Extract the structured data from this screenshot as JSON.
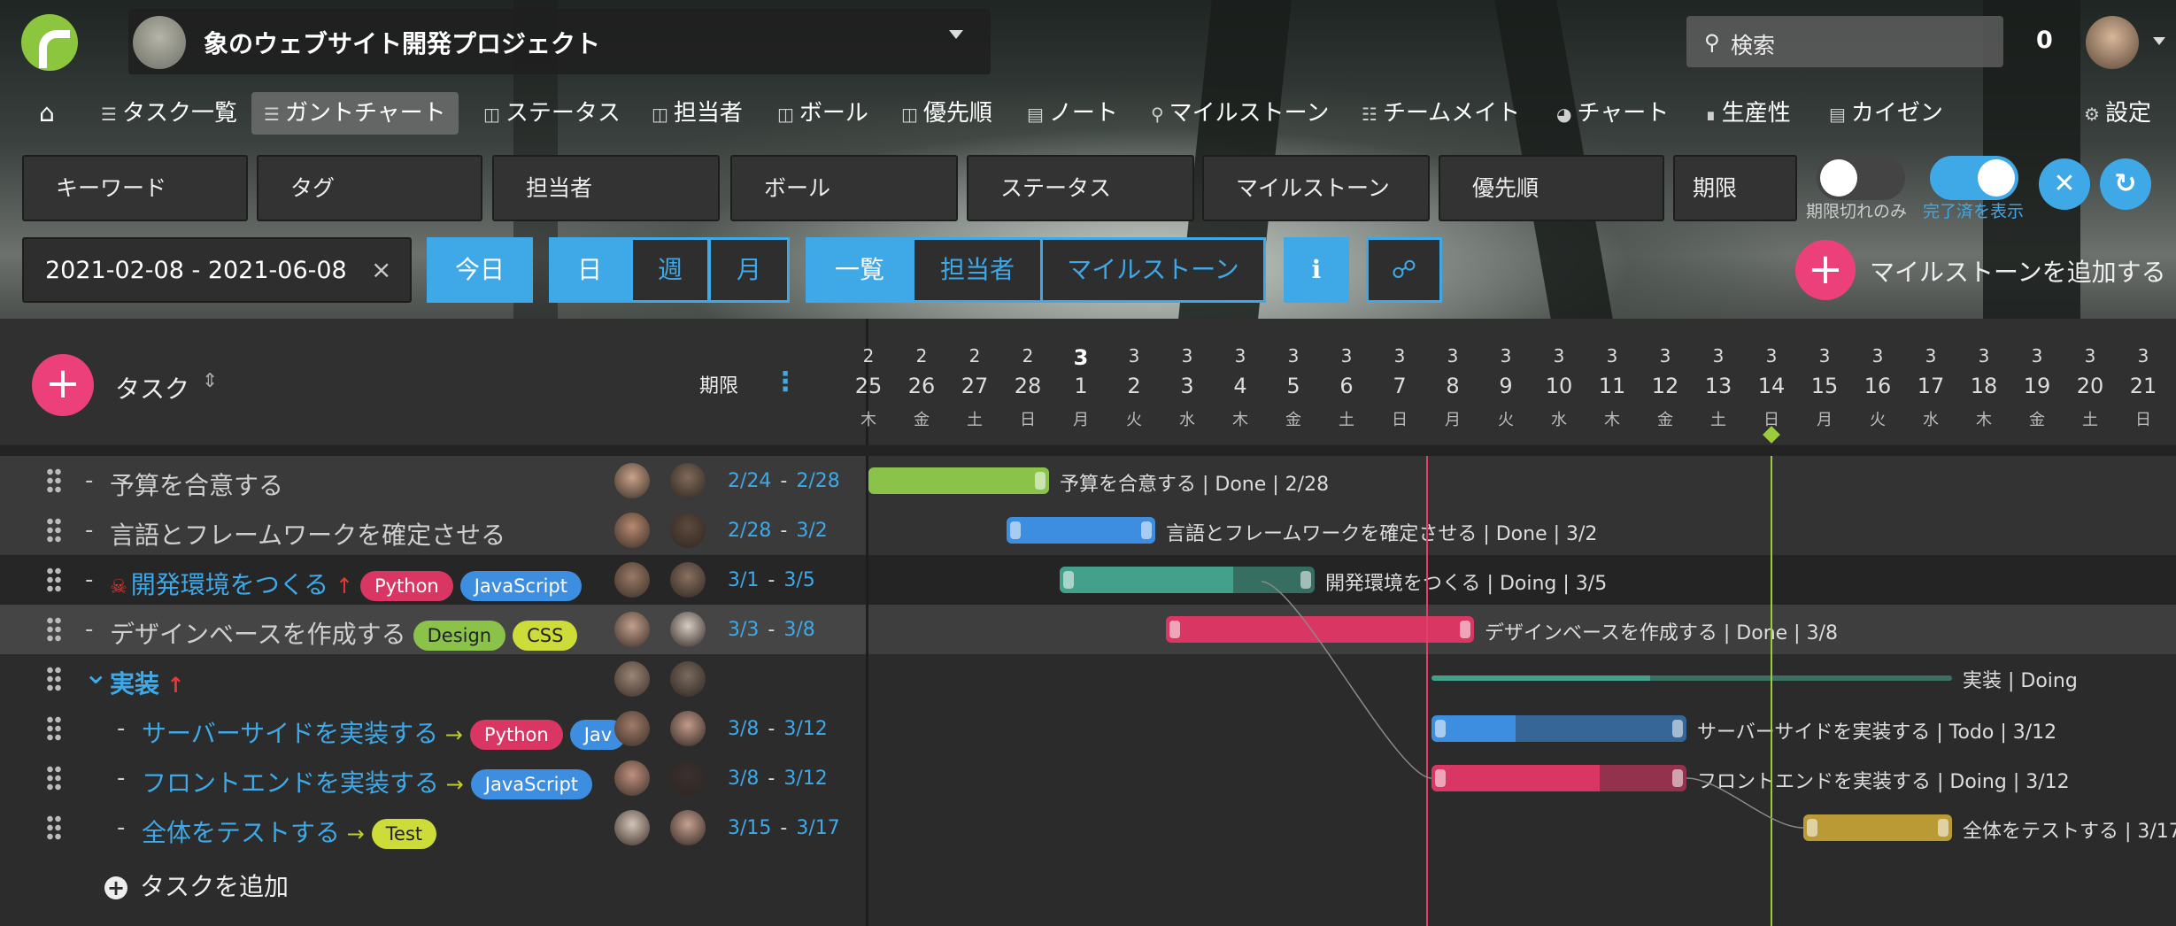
{
  "header": {
    "project_title": "象のウェブサイト開発プロジェクト",
    "search_placeholder": "検索",
    "notification_count": "0"
  },
  "nav": {
    "home_icon": "home-icon",
    "items": [
      {
        "label": "タスク一覧",
        "icon": "list-icon"
      },
      {
        "label": "ガントチャート",
        "icon": "gantt-icon",
        "active": true
      },
      {
        "label": "ステータス",
        "icon": "board-icon"
      },
      {
        "label": "担当者",
        "icon": "board-icon"
      },
      {
        "label": "ボール",
        "icon": "board-icon"
      },
      {
        "label": "優先順",
        "icon": "board-icon"
      },
      {
        "label": "ノート",
        "icon": "note-icon"
      },
      {
        "label": "マイルストーン",
        "icon": "pin-icon"
      },
      {
        "label": "チームメイト",
        "icon": "team-icon"
      },
      {
        "label": "チャート",
        "icon": "pie-icon"
      },
      {
        "label": "生産性",
        "icon": "chart-icon"
      },
      {
        "label": "カイゼン",
        "icon": "kaizen-icon"
      }
    ],
    "settings_label": "設定"
  },
  "filters": {
    "keyword": "キーワード",
    "tag": "タグ",
    "assignee": "担当者",
    "ball": "ボール",
    "status": "ステータス",
    "milestone": "マイルストーン",
    "priority": "優先順",
    "due": "期限",
    "overdue_only_label": "期限切れのみ",
    "show_completed_label": "完了済を表示",
    "overdue_only_on": false,
    "show_completed_on": true
  },
  "controls": {
    "date_range": "2021-02-08 - 2021-06-08",
    "clear": "×",
    "today": "今日",
    "scale": [
      "日",
      "週",
      "月"
    ],
    "view": [
      "一覧",
      "担当者",
      "マイルストーン"
    ],
    "info_icon": "i",
    "add_milestone": "マイルストーンを追加する"
  },
  "task_list": {
    "header_title": "タスク",
    "header_due": "期限",
    "add_task": "タスクを追加",
    "tasks": [
      {
        "title": "予算を合意する",
        "dash": "-",
        "tags": [],
        "start": "2/24",
        "sep": "-",
        "end": "2/28"
      },
      {
        "title": "言語とフレームワークを確定させる",
        "dash": "-",
        "tags": [],
        "start": "2/28",
        "sep": "-",
        "end": "3/2"
      },
      {
        "title": "開発環境をつくる",
        "dash": "-",
        "tags": [
          "Python",
          "JavaScript"
        ],
        "start": "3/1",
        "sep": "-",
        "end": "3/5"
      },
      {
        "title": "デザインベースを作成する",
        "dash": "-",
        "tags": [
          "Design",
          "CSS"
        ],
        "start": "3/3",
        "sep": "-",
        "end": "3/8"
      },
      {
        "title": "実装",
        "dash": "",
        "tags": [],
        "start": "",
        "sep": "",
        "end": ""
      },
      {
        "title": "サーバーサイドを実装する",
        "dash": "-",
        "tags": [
          "Python",
          "Jav"
        ],
        "start": "3/8",
        "sep": "-",
        "end": "3/12"
      },
      {
        "title": "フロントエンドを実装する",
        "dash": "-",
        "tags": [
          "JavaScript"
        ],
        "start": "3/8",
        "sep": "-",
        "end": "3/12"
      },
      {
        "title": "全体をテストする",
        "dash": "-",
        "tags": [
          "Test"
        ],
        "start": "3/15",
        "sep": "-",
        "end": "3/17"
      }
    ]
  },
  "gantt": {
    "days": [
      {
        "mo": "2",
        "d": "25",
        "wd": "木"
      },
      {
        "mo": "2",
        "d": "26",
        "wd": "金"
      },
      {
        "mo": "2",
        "d": "27",
        "wd": "土"
      },
      {
        "mo": "2",
        "d": "28",
        "wd": "日"
      },
      {
        "mo": "3",
        "d": "1",
        "wd": "月"
      },
      {
        "mo": "3",
        "d": "2",
        "wd": "火"
      },
      {
        "mo": "3",
        "d": "3",
        "wd": "水"
      },
      {
        "mo": "3",
        "d": "4",
        "wd": "木"
      },
      {
        "mo": "3",
        "d": "5",
        "wd": "金"
      },
      {
        "mo": "3",
        "d": "6",
        "wd": "土"
      },
      {
        "mo": "3",
        "d": "7",
        "wd": "日"
      },
      {
        "mo": "3",
        "d": "8",
        "wd": "月"
      },
      {
        "mo": "3",
        "d": "9",
        "wd": "火"
      },
      {
        "mo": "3",
        "d": "10",
        "wd": "水"
      },
      {
        "mo": "3",
        "d": "11",
        "wd": "木"
      },
      {
        "mo": "3",
        "d": "12",
        "wd": "金"
      },
      {
        "mo": "3",
        "d": "13",
        "wd": "土"
      },
      {
        "mo": "3",
        "d": "14",
        "wd": "日"
      },
      {
        "mo": "3",
        "d": "15",
        "wd": "月"
      },
      {
        "mo": "3",
        "d": "16",
        "wd": "火"
      },
      {
        "mo": "3",
        "d": "17",
        "wd": "水"
      },
      {
        "mo": "3",
        "d": "18",
        "wd": "木"
      },
      {
        "mo": "3",
        "d": "19",
        "wd": "金"
      },
      {
        "mo": "3",
        "d": "20",
        "wd": "土"
      },
      {
        "mo": "3",
        "d": "21",
        "wd": "日"
      }
    ],
    "bar_labels": [
      "予算を合意する | Done | 2/28",
      "言語とフレームワークを確定させる | Done | 3/2",
      "開発環境をつくる | Doing | 3/5",
      "デザインベースを作成する | Done | 3/8",
      "実装 | Doing",
      "サーバーサイドを実装する | Todo | 3/12",
      "フロントエンドを実装する | Doing | 3/12",
      "全体をテストする | 3/17"
    ],
    "today_marker": "3/8",
    "milestone_marker": "3/14"
  },
  "colors": {
    "accent": "#3fa9e8",
    "add": "#ec407a",
    "done_green": "#8bc34a",
    "teal": "#43a08a",
    "blue": "#3d8de0",
    "pink": "#d93664",
    "mustard": "#b99a35",
    "today_line": "#e0406a",
    "milestone_line": "#9ccc3c"
  }
}
